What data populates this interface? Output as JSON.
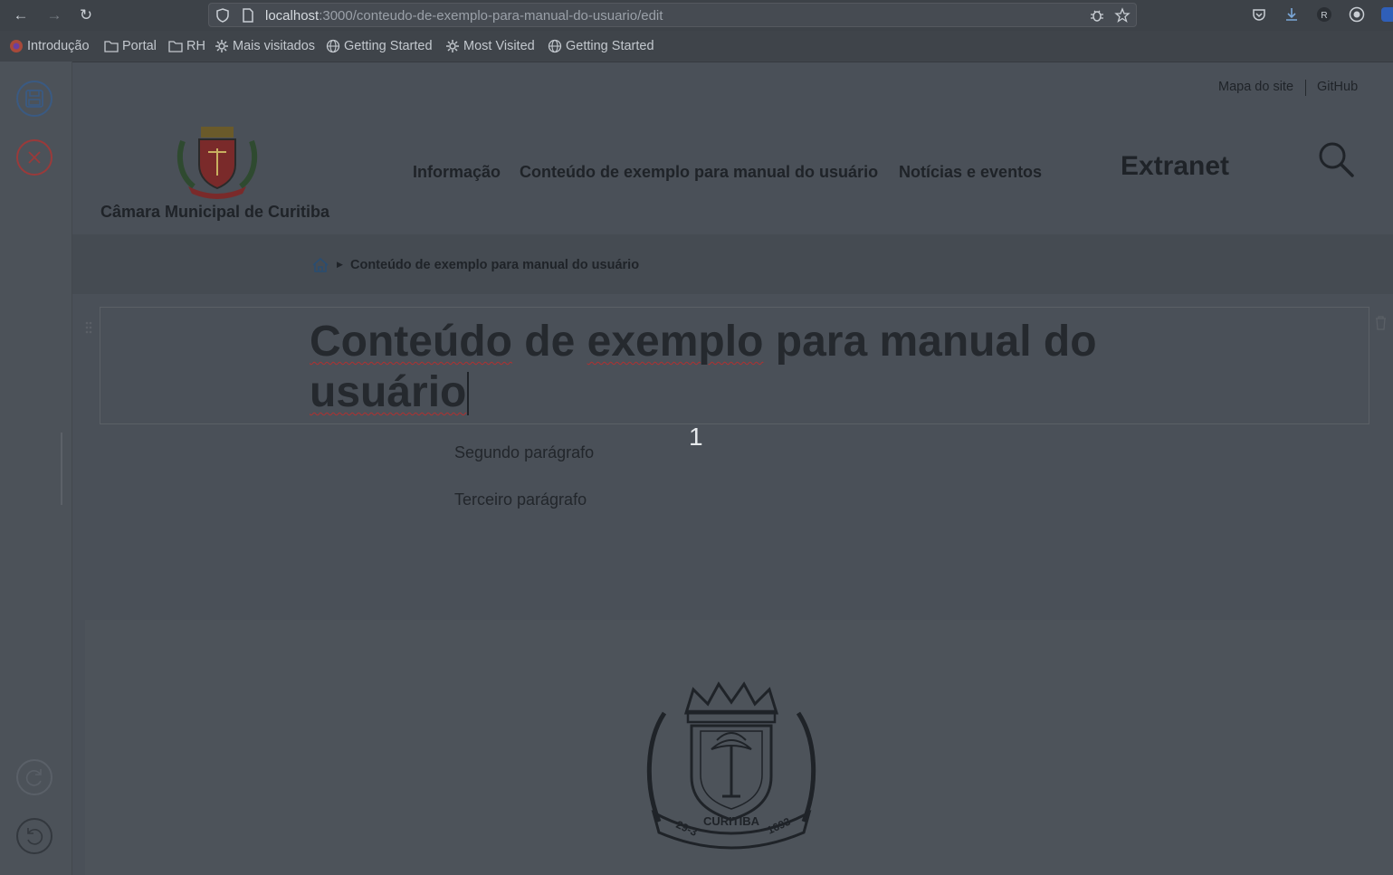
{
  "browser": {
    "url_host": "localhost",
    "url_path": ":3000/conteudo-de-exemplo-para-manual-do-usuario/edit",
    "bookmarks": [
      {
        "label": "Introdução",
        "icon": "firefox-icon"
      },
      {
        "label": "Portal",
        "icon": "folder-icon"
      },
      {
        "label": "RH",
        "icon": "folder-icon"
      },
      {
        "label": "Mais visitados",
        "icon": "gear-icon"
      },
      {
        "label": "Getting Started",
        "icon": "globe-icon"
      },
      {
        "label": "Most Visited",
        "icon": "gear-icon"
      },
      {
        "label": "Getting Started",
        "icon": "globe-icon"
      }
    ]
  },
  "header": {
    "links": [
      "Mapa do site",
      "GitHub"
    ],
    "site_title": "Câmara Municipal de Curitiba",
    "menu": [
      "Informação",
      "Conteúdo de exemplo para manual do usuário",
      "Notícias e eventos"
    ],
    "extranet": "Extranet"
  },
  "breadcrumb": {
    "current": "Conteúdo de exemplo para manual do usuário"
  },
  "content": {
    "title_words": [
      "Conteúdo",
      "de",
      "exemplo",
      "para",
      "manual",
      "do",
      "usuário"
    ],
    "block_number": "1",
    "paragraphs": [
      "Segundo parágrafo",
      "Terceiro parágrafo"
    ]
  },
  "colors": {
    "overlay_bg": "#4a5058",
    "save_accent": "#3a5a82",
    "cancel_accent": "#9a3a3a",
    "spell_error": "#b03030"
  }
}
